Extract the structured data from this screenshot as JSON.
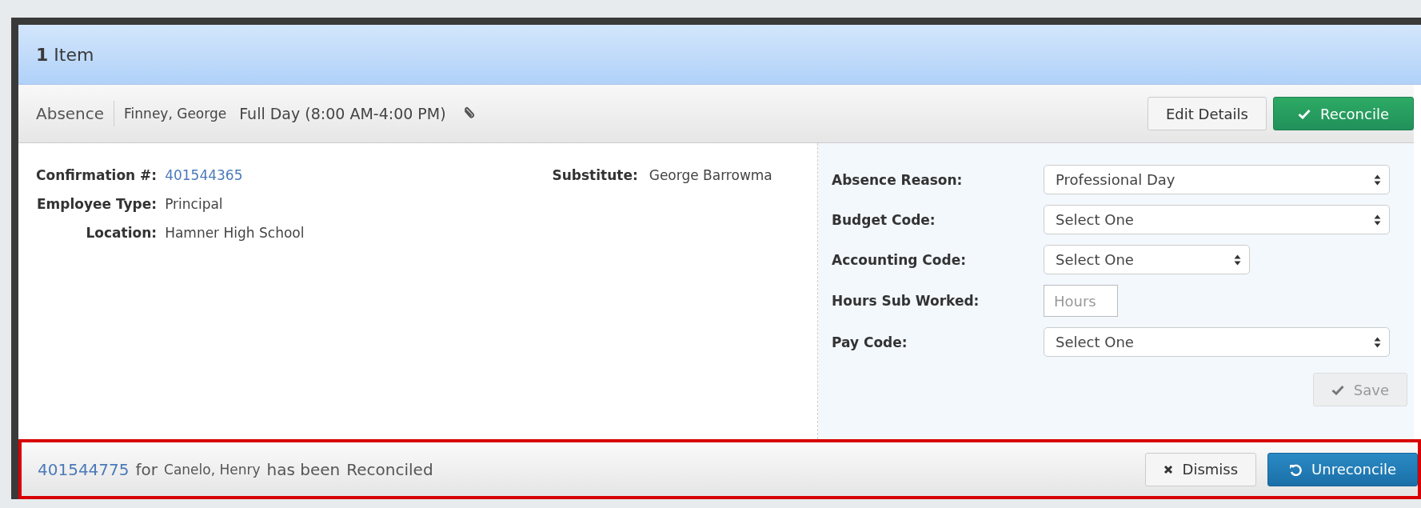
{
  "header": {
    "count": "1",
    "label": "Item"
  },
  "item_bar": {
    "type": "Absence",
    "employee": "Finney, George",
    "duration": "Full Day (8:00 AM-4:00 PM)",
    "attachment": true,
    "buttons": [
      {
        "kind": "default",
        "label": "Edit Details"
      },
      {
        "kind": "success",
        "label": "Reconcile"
      }
    ]
  },
  "details": [
    {
      "label": "Confirmation #:",
      "value": "401544365",
      "kind": "link"
    },
    {
      "label": "Employee Type:",
      "value": "Principal",
      "kind": "text"
    },
    {
      "label": "Location:",
      "value": "Hamner High School",
      "kind": "text"
    }
  ],
  "substitute": {
    "label": "Substitute:",
    "value": "George Barrowma"
  },
  "form": [
    {
      "kind": "select",
      "label": "Absence Reason:",
      "value": "Professional Day"
    },
    {
      "kind": "select",
      "label": "Budget Code:",
      "value": "Select One"
    },
    {
      "kind": "short-select",
      "label": "Accounting Code:",
      "value": "Select One"
    },
    {
      "kind": "input",
      "label": "Hours Sub Worked:",
      "placeholder": "Hours"
    },
    {
      "kind": "select",
      "label": "Pay Code:",
      "value": "Select One"
    }
  ],
  "save": {
    "label": "Save",
    "disabled": true
  },
  "notification": {
    "confirmation": "401544775",
    "for": "for",
    "employee": "Canelo, Henry",
    "message": "has been",
    "status": "Reconciled",
    "buttons": [
      {
        "kind": "dismiss",
        "label": "Dismiss"
      },
      {
        "kind": "unreconcile",
        "label": "Unreconcile"
      }
    ]
  }
}
